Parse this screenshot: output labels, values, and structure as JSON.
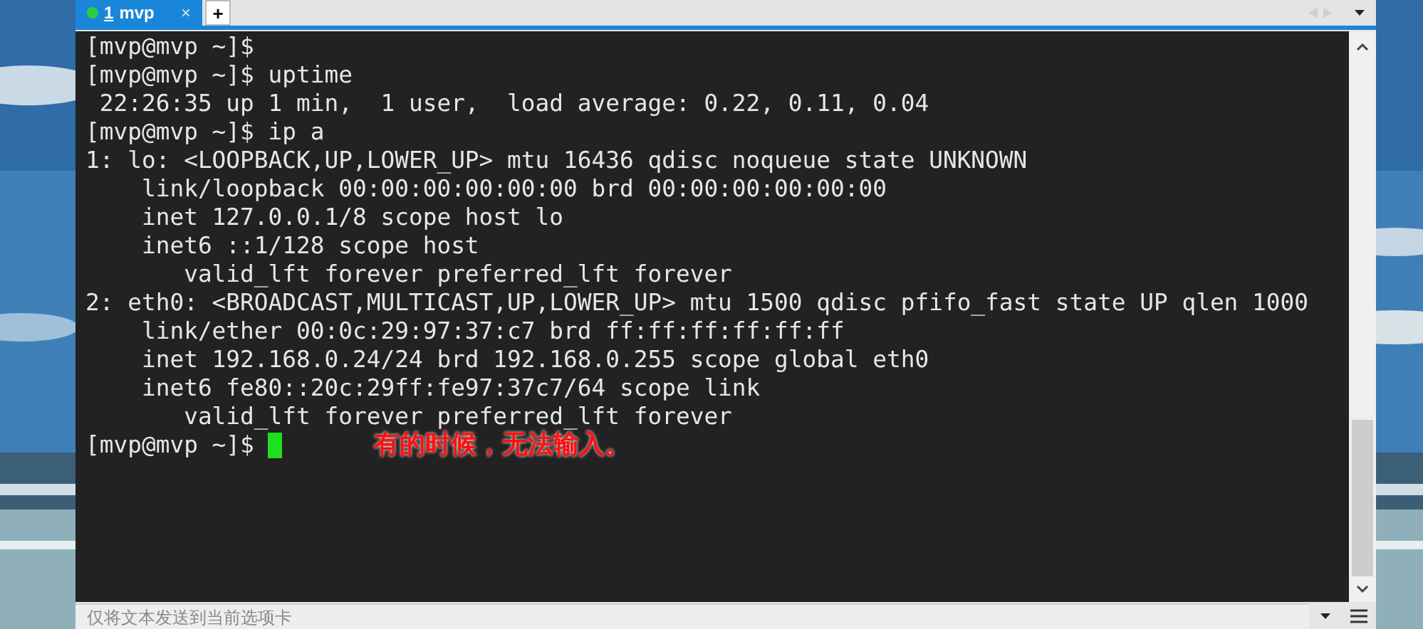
{
  "tabs": [
    {
      "index": "1",
      "label": "mvp",
      "selected": true,
      "close": "×"
    }
  ],
  "new_tab": "+",
  "terminal": {
    "lines": [
      "[mvp@mvp ~]$",
      "[mvp@mvp ~]$ uptime",
      " 22:26:35 up 1 min,  1 user,  load average: 0.22, 0.11, 0.04",
      "[mvp@mvp ~]$ ip a",
      "1: lo: <LOOPBACK,UP,LOWER_UP> mtu 16436 qdisc noqueue state UNKNOWN",
      "    link/loopback 00:00:00:00:00:00 brd 00:00:00:00:00:00",
      "    inet 127.0.0.1/8 scope host lo",
      "    inet6 ::1/128 scope host",
      "       valid_lft forever preferred_lft forever",
      "2: eth0: <BROADCAST,MULTICAST,UP,LOWER_UP> mtu 1500 qdisc pfifo_fast state UP qlen 1000",
      "    link/ether 00:0c:29:97:37:c7 brd ff:ff:ff:ff:ff:ff",
      "    inet 192.168.0.24/24 brd 192.168.0.255 scope global eth0",
      "    inet6 fe80::20c:29ff:fe97:37c7/64 scope link",
      "       valid_lft forever preferred_lft forever"
    ],
    "prompt": "[mvp@mvp ~]$",
    "cursor": true
  },
  "annotation": "有的时候，无法输入。",
  "send_bar": {
    "placeholder": "仅将文本发送到当前选项卡"
  }
}
